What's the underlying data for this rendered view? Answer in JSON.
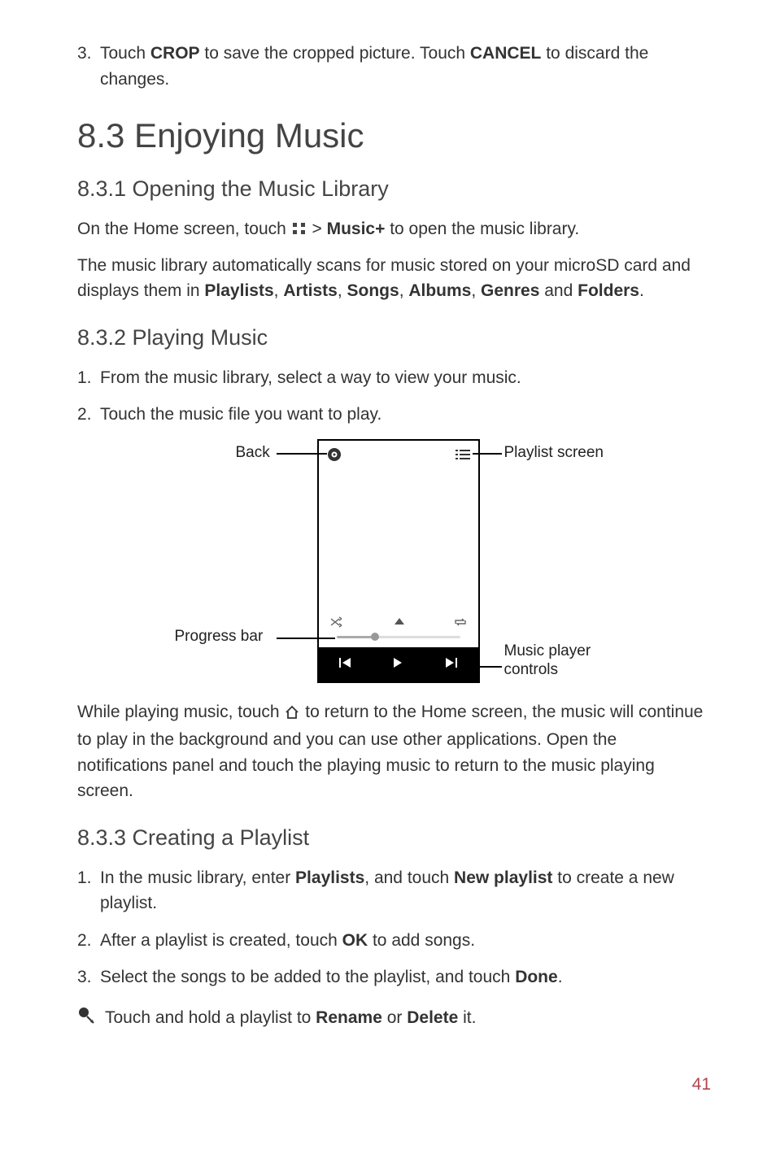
{
  "step3_crop": {
    "num": "3.",
    "pre": "Touch ",
    "b1": "CROP",
    "mid": " to save the cropped picture. Touch ",
    "b2": "CANCEL",
    "post": " to discard the changes."
  },
  "h1": "8.3  Enjoying Music",
  "s831": {
    "title": "8.3.1  Opening the Music Library",
    "p1a": "On the Home screen, touch ",
    "p1b": " > ",
    "p1c": "Music+",
    "p1d": " to open the music library.",
    "p2a": "The music library automatically scans for music stored on your microSD card and displays them in ",
    "p2b": "Playlists",
    "p2c": ", ",
    "p2d": "Artists",
    "p2e": ", ",
    "p2f": "Songs",
    "p2g": ", ",
    "p2h": "Albums",
    "p2i": ", ",
    "p2j": "Genres",
    "p2k": " and ",
    "p2l": "Folders",
    "p2m": "."
  },
  "s832": {
    "title": "8.3.2  Playing Music",
    "step1": {
      "num": "1.",
      "txt": "From the music library, select a way to view your music."
    },
    "step2": {
      "num": "2.",
      "txt": "Touch the music file you want to play."
    },
    "diagram": {
      "back": "Back",
      "playlist": "Playlist screen",
      "progress": "Progress bar",
      "controls1": "Music player",
      "controls2": "controls"
    },
    "para_a": "While playing music, touch ",
    "para_b": " to return to the Home screen, the music will continue to play in the background and you can use other applications. Open the notifications panel and touch the playing music to return to the music playing screen."
  },
  "s833": {
    "title": "8.3.3  Creating a Playlist",
    "step1": {
      "num": "1.",
      "a": "In the music library, enter ",
      "b": "Playlists",
      "c": ", and touch ",
      "d": "New playlist",
      "e": " to create a new playlist."
    },
    "step2": {
      "num": "2.",
      "a": "After a playlist is created, touch ",
      "b": "OK",
      "c": " to add songs."
    },
    "step3": {
      "num": "3.",
      "a": "Select the songs to be added to the playlist, and touch ",
      "b": "Done",
      "c": "."
    },
    "tip": {
      "a": "Touch and hold a playlist to ",
      "b": "Rename",
      "c": " or ",
      "d": "Delete",
      "e": " it."
    }
  },
  "page_number": "41"
}
